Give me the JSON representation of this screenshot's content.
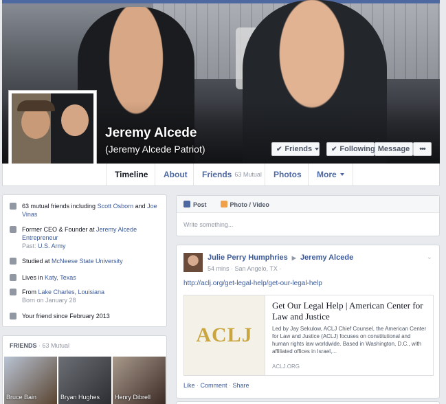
{
  "profile": {
    "name": "Jeremy Alcede",
    "alternate_name": "(Jeremy Alcede Patriot)"
  },
  "cover_actions": {
    "friends_label": "Friends",
    "following_label": "Following",
    "message_label": "Message",
    "more_label": "•••"
  },
  "nav": {
    "tabs": [
      {
        "label": "Timeline"
      },
      {
        "label": "About"
      },
      {
        "label": "Friends",
        "count": "63 Mutual"
      },
      {
        "label": "Photos"
      },
      {
        "label": "More"
      }
    ]
  },
  "intro": {
    "mutual_prefix": "63 mutual friends including ",
    "mutual_name1": "Scott Osborn",
    "mutual_and": " and ",
    "mutual_name2": "Joe Vinas",
    "work_prefix": "Former CEO & Founder at ",
    "work_company": "Jeremy Alcede Entrepreneur",
    "past_prefix": "Past: ",
    "past_value": "U.S. Army",
    "study_prefix": "Studied at ",
    "study_school": "McNeese State University",
    "lives_prefix": "Lives in ",
    "lives_place": "Katy, Texas",
    "from_prefix": "From ",
    "from_place": "Lake Charles, Louisiana",
    "born": "Born on January 28",
    "friend_since": "Your friend since February 2013"
  },
  "friends_box": {
    "title": "FRIENDS",
    "count": "· 63 Mutual",
    "items": [
      {
        "name": "Bruce Bain"
      },
      {
        "name": "Bryan Hughes"
      },
      {
        "name": "Henry Dibrell"
      }
    ]
  },
  "composer": {
    "post_label": "Post",
    "photo_label": "Photo / Video",
    "placeholder": "Write something..."
  },
  "post": {
    "author": "Julie Perry Humphries",
    "target": "Jeremy Alcede",
    "meta": "54 mins · San Angelo, TX ·",
    "url": "http://aclj.org/get-legal-help/get-our-legal-help",
    "share_logo": "ACLJ",
    "share_title": "Get Our Legal Help | American Center for Law and Justice",
    "share_desc": "Led by Jay Sekulow, ACLJ Chief Counsel, the American Center for Law and Justice (ACLJ) focuses on constitutional and human rights law worldwide. Based in Washington, D.C., with affiliated offices in Israel,...",
    "share_domain": "ACLJ.ORG",
    "like": "Like",
    "comment": "Comment",
    "share": "Share",
    "sep": " · "
  }
}
